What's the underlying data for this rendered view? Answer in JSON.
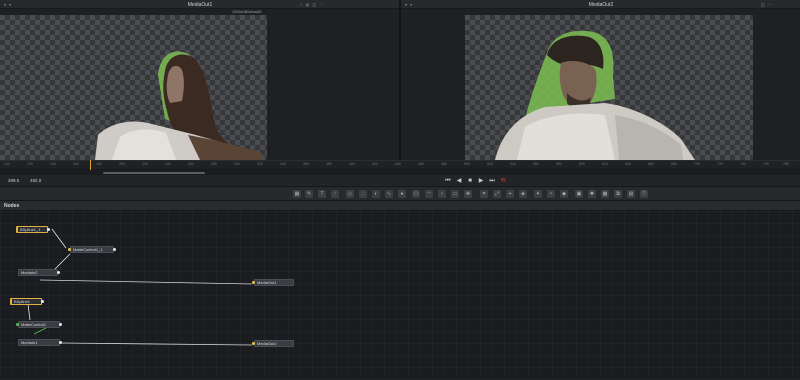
{
  "viewers": {
    "left": {
      "title": "MediaOut1",
      "resolution": "1920x1080xfloat32"
    },
    "right": {
      "title": "MediaOut2"
    }
  },
  "transport": {
    "range_start": "289.0",
    "range_end": "492.0"
  },
  "ruler_ticks": [
    "100",
    "120",
    "140",
    "160",
    "180",
    "200",
    "220",
    "240",
    "260",
    "280",
    "300",
    "320",
    "340",
    "360",
    "380",
    "400",
    "420",
    "440",
    "460",
    "480",
    "500",
    "520",
    "540",
    "560",
    "580",
    "600",
    "620",
    "640",
    "660",
    "680",
    "700",
    "720",
    "740",
    "760",
    "780"
  ],
  "nodes_panel": {
    "title": "Nodes"
  },
  "nodes": {
    "bspline1_1": "BSpline1_1",
    "mattecontrol1_1": "MatteControl1_1",
    "mediain2": "MediaIn2",
    "mediaout1": "MediaOut1",
    "bspline1": "BSpline1",
    "mattecontrol1": "MatteControl1",
    "mediain1": "MediaIn1",
    "mediaout2": "MediaOut2"
  },
  "colors": {
    "accent_loop": "#e0484a",
    "playhead": "#e0a030",
    "bspline_outline": "#e0b040",
    "mask_green": "#7cbf52"
  }
}
